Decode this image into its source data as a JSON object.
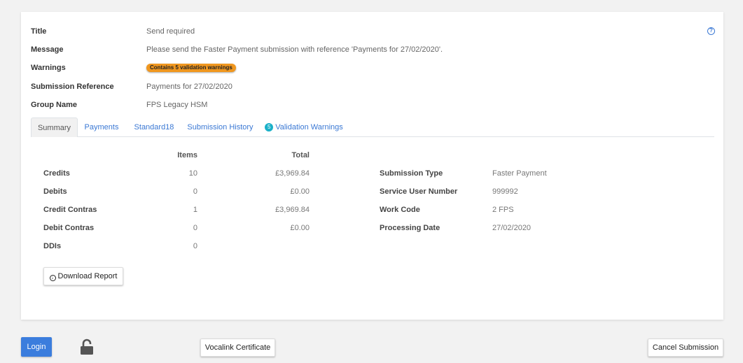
{
  "header": {
    "title_label": "Title",
    "title_value": "Send required",
    "message_label": "Message",
    "message_value": "Please send the Faster Payment submission with reference 'Payments for 27/02/2020'.",
    "warnings_label": "Warnings",
    "warnings_badge": "Contains 5 validation warnings",
    "submission_reference_label": "Submission Reference",
    "submission_reference_value": "Payments for 27/02/2020",
    "group_name_label": "Group Name",
    "group_name_value": "FPS Legacy HSM",
    "help_icon": "?"
  },
  "tabs": [
    {
      "label": "Summary",
      "active": true
    },
    {
      "label": "Payments"
    },
    {
      "label": "Standard18"
    },
    {
      "label": "Submission History"
    },
    {
      "label": "Validation Warnings",
      "count": "5"
    }
  ],
  "summary": {
    "items_header": "Items",
    "total_header": "Total",
    "rows": [
      {
        "label": "Credits",
        "items": "10",
        "total": "£3,969.84"
      },
      {
        "label": "Debits",
        "items": "0",
        "total": "£0.00"
      },
      {
        "label": "Credit Contras",
        "items": "1",
        "total": "£3,969.84"
      },
      {
        "label": "Debit Contras",
        "items": "0",
        "total": "£0.00"
      },
      {
        "label": "DDIs",
        "items": "0",
        "total": ""
      }
    ]
  },
  "details": [
    {
      "label": "Submission Type",
      "value": "Faster Payment"
    },
    {
      "label": "Service User Number",
      "value": "999992"
    },
    {
      "label": "Work Code",
      "value": "2 FPS"
    },
    {
      "label": "Processing Date",
      "value": "27/02/2020"
    }
  ],
  "download_report_label": "Download Report",
  "footer": {
    "login_label": "Login",
    "vocalink_label": "Vocalink Certificate",
    "cancel_label": "Cancel Submission"
  },
  "colors": {
    "accent": "#3b7ddd",
    "warning_badge": "#f0971f",
    "count_badge": "#1ab0c8"
  },
  "icons": {
    "help": "question-circle-icon",
    "download": "download-circle-icon",
    "lock": "unlocked-padlock-icon"
  }
}
